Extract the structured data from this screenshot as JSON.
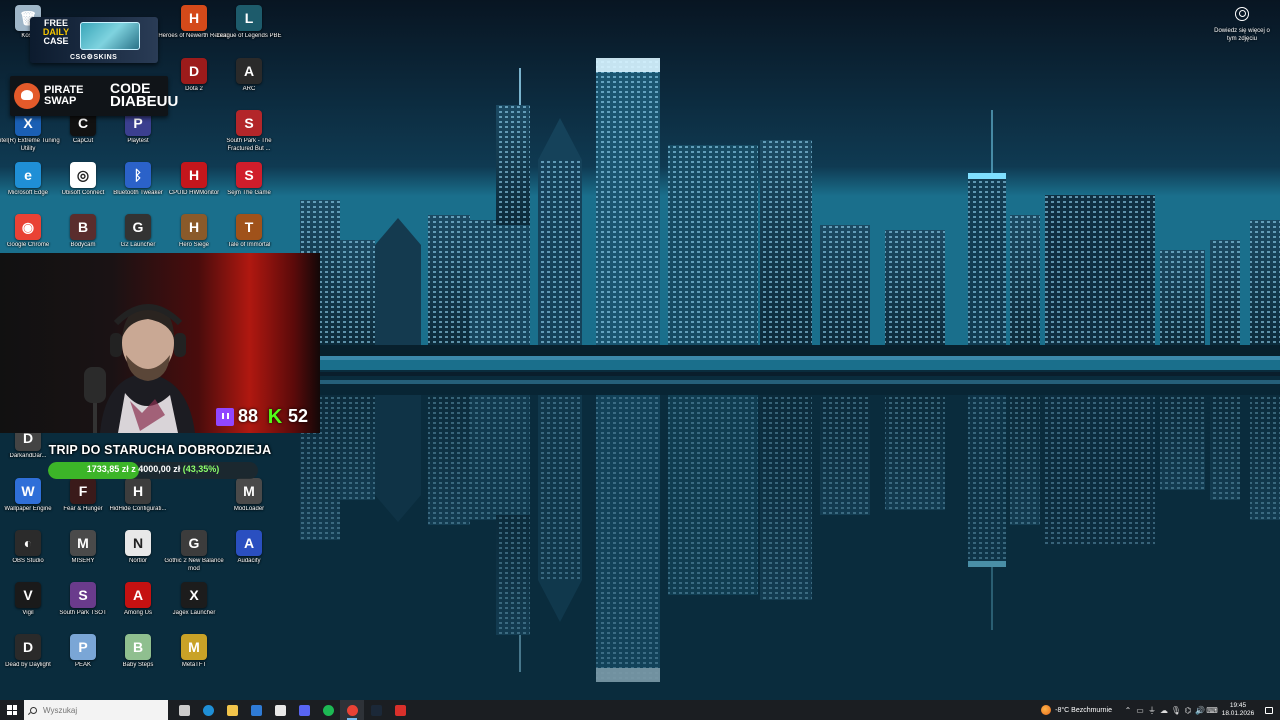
{
  "desktop_icons": [
    {
      "name": "recycle-bin-icon",
      "label": "Kosz",
      "color": "#9fb6c8",
      "glyph": "🗑",
      "col": 0,
      "row": 0
    },
    {
      "name": "heroes-of-newerth-icon",
      "label": "Heroes of Newerth Reborn",
      "color": "#d44a1a",
      "glyph": "H",
      "col": 3,
      "row": 0
    },
    {
      "name": "league-of-legends-pbe-icon",
      "label": "League of Legends PBE",
      "color": "#1d5b6b",
      "glyph": "L",
      "col": 4,
      "row": 0
    },
    {
      "name": "dota2-icon",
      "label": "Dota 2",
      "color": "#9c1b1b",
      "glyph": "D",
      "col": 3,
      "row": 1
    },
    {
      "name": "arc-icon",
      "label": "ARC",
      "color": "#2a2a2a",
      "glyph": "A",
      "col": 4,
      "row": 1
    },
    {
      "name": "intel-xtu-icon",
      "label": "Intel(R) Extreme Tuning Utility",
      "color": "#1a5fb4",
      "glyph": "X",
      "col": 0,
      "row": 2
    },
    {
      "name": "capcut-icon",
      "label": "CapCut",
      "color": "#111111",
      "glyph": "C",
      "col": 1,
      "row": 2
    },
    {
      "name": "playtest-icon",
      "label": "Playtest",
      "color": "#3b3f8f",
      "glyph": "P",
      "col": 2,
      "row": 2
    },
    {
      "name": "south-park-fractured-icon",
      "label": "South Park - The Fractured But ...",
      "color": "#b3262a",
      "glyph": "S",
      "col": 4,
      "row": 2
    },
    {
      "name": "microsoft-edge-icon",
      "label": "Microsoft Edge",
      "color": "#1f8fd6",
      "glyph": "e",
      "col": 0,
      "row": 3
    },
    {
      "name": "ubisoft-connect-icon",
      "label": "Ubisoft Connect",
      "color": "#ffffff",
      "glyph": "◎",
      "col": 1,
      "row": 3
    },
    {
      "name": "bluetooth-tweaker-icon",
      "label": "Bluetooth Tweaker",
      "color": "#2b62c9",
      "glyph": "ᛒ",
      "col": 2,
      "row": 3
    },
    {
      "name": "cpuid-hwmonitor-icon",
      "label": "CPUID HWMonitor",
      "color": "#c4161c",
      "glyph": "H",
      "col": 3,
      "row": 3
    },
    {
      "name": "sejm-the-game-icon",
      "label": "Sejm The Game",
      "color": "#d01d2b",
      "glyph": "S",
      "col": 4,
      "row": 3
    },
    {
      "name": "google-chrome-icon",
      "label": "Google Chrome",
      "color": "#e94235",
      "glyph": "◉",
      "col": 0,
      "row": 4
    },
    {
      "name": "bodycam-icon",
      "label": "Bodycam",
      "color": "#5a2d2d",
      "glyph": "B",
      "col": 1,
      "row": 4
    },
    {
      "name": "g2-launcher-icon",
      "label": "G2 Launcher",
      "color": "#333333",
      "glyph": "G",
      "col": 2,
      "row": 4
    },
    {
      "name": "hero-siege-icon",
      "label": "Hero Siege",
      "color": "#8a5a2a",
      "glyph": "H",
      "col": 3,
      "row": 4
    },
    {
      "name": "tale-of-immortal-icon",
      "label": "Tale of Immortal",
      "color": "#a0521a",
      "glyph": "T",
      "col": 4,
      "row": 4
    },
    {
      "name": "dearbound-icon",
      "label": "DarkandDar...",
      "color": "#444444",
      "glyph": "D",
      "col": 0,
      "row": 8
    },
    {
      "name": "wallpaper-engine-icon",
      "label": "Wallpaper Engine",
      "color": "#2f6fd8",
      "glyph": "W",
      "col": 0,
      "row": 9
    },
    {
      "name": "fear-hunger-icon",
      "label": "Fear & Hunger",
      "color": "#3a1a1a",
      "glyph": "F",
      "col": 1,
      "row": 9
    },
    {
      "name": "hidehide-icon",
      "label": "HidHide Configurati...",
      "color": "#3d3d3d",
      "glyph": "H",
      "col": 2,
      "row": 9
    },
    {
      "name": "modloader-icon",
      "label": "ModLoader",
      "color": "#4a4a4a",
      "glyph": "M",
      "col": 4,
      "row": 9
    },
    {
      "name": "obs-studio-icon",
      "label": "OBS Studio",
      "color": "#2b2b2b",
      "glyph": "◐",
      "col": 0,
      "row": 10
    },
    {
      "name": "misery-icon",
      "label": "MISERY",
      "color": "#4a4a4a",
      "glyph": "M",
      "col": 1,
      "row": 10
    },
    {
      "name": "nortlor-icon",
      "label": "Nortlor",
      "color": "#e8e8e8",
      "glyph": "N",
      "col": 2,
      "row": 10
    },
    {
      "name": "gothic-balance-icon",
      "label": "Gothic 2 New Balance mod",
      "color": "#3c3c3c",
      "glyph": "G",
      "col": 3,
      "row": 10
    },
    {
      "name": "audacity-icon",
      "label": "Audacity",
      "color": "#2a4fc0",
      "glyph": "A",
      "col": 4,
      "row": 10
    },
    {
      "name": "vigil-icon",
      "label": "Vigil",
      "color": "#1a1a1a",
      "glyph": "V",
      "col": 0,
      "row": 11
    },
    {
      "name": "south-park-tsot-icon",
      "label": "South Park TSOT",
      "color": "#6a3b8c",
      "glyph": "S",
      "col": 1,
      "row": 11
    },
    {
      "name": "among-us-icon",
      "label": "Among Us",
      "color": "#c51111",
      "glyph": "A",
      "col": 2,
      "row": 11
    },
    {
      "name": "jagex-launcher-icon",
      "label": "Jagex Launcher",
      "color": "#1c1c1c",
      "glyph": "X",
      "col": 3,
      "row": 11
    },
    {
      "name": "dead-by-daylight-icon",
      "label": "Dead by Daylight",
      "color": "#2a2a2a",
      "glyph": "D",
      "col": 0,
      "row": 12
    },
    {
      "name": "peak-icon",
      "label": "PEAK",
      "color": "#7aa6d6",
      "glyph": "P",
      "col": 1,
      "row": 12
    },
    {
      "name": "baby-steps-icon",
      "label": "Baby Steps",
      "color": "#8fbf8f",
      "glyph": "B",
      "col": 2,
      "row": 12
    },
    {
      "name": "metatft-icon",
      "label": "MetaTFT",
      "color": "#c9a227",
      "glyph": "M",
      "col": 3,
      "row": 12
    }
  ],
  "promo_csgo": {
    "free_line1": "FREE",
    "free_line2": "DAILY",
    "free_line3": "CASE",
    "brand": "CSG⚙SKINS"
  },
  "promo_pirate": {
    "name_line1": "PIRATE",
    "name_line2": "SWAP",
    "code_label": "CODE",
    "code_value": "DIABEUU"
  },
  "webcam": {
    "twitch_viewers": "88",
    "kick_viewers": "52"
  },
  "donation_goal": {
    "title": "TRIP DO STARUCHA DOBRODZIEJA",
    "progress_text": "1733,85 zł z 4000,00 zł",
    "percent_text": "(43,35%)",
    "progress": 0.4335
  },
  "corner_info": {
    "text": "Dowiedz się więcej o tym zdjęciu"
  },
  "taskbar": {
    "search_placeholder": "Wyszukaj",
    "apps": [
      {
        "name": "taskbar-task-view",
        "color": "#cccccc",
        "active": false
      },
      {
        "name": "taskbar-edge",
        "color": "#1f8fd6",
        "active": false
      },
      {
        "name": "taskbar-file-explorer",
        "color": "#f2c44b",
        "active": false
      },
      {
        "name": "taskbar-mail",
        "color": "#2f7bd6",
        "active": false
      },
      {
        "name": "taskbar-store",
        "color": "#e8e8e8",
        "active": false
      },
      {
        "name": "taskbar-discord",
        "color": "#5865f2",
        "active": false
      },
      {
        "name": "taskbar-spotify",
        "color": "#1db954",
        "active": false
      },
      {
        "name": "taskbar-chrome",
        "color": "#e94235",
        "active": true
      },
      {
        "name": "taskbar-steam",
        "color": "#1b2838",
        "active": false
      },
      {
        "name": "taskbar-recorder",
        "color": "#d9302b",
        "active": false
      }
    ],
    "weather": "-8°C  Bezchmurnie",
    "time": "19:45",
    "date": "18.01.2026"
  }
}
